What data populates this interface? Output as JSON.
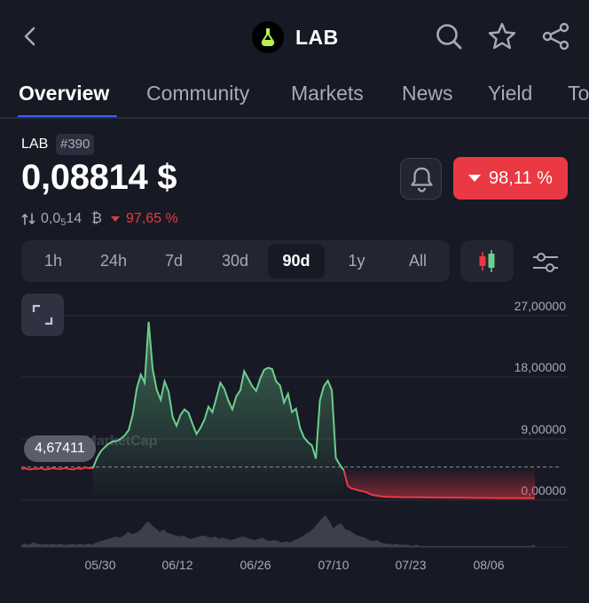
{
  "header": {
    "title": "LAB",
    "back_icon": "chevron-left-icon",
    "logo_icon": "lab-flask-logo",
    "actions": [
      "search-icon",
      "star-icon",
      "share-icon"
    ]
  },
  "tabs": [
    {
      "label": "Overview",
      "active": true
    },
    {
      "label": "Community"
    },
    {
      "label": "Markets"
    },
    {
      "label": "News"
    },
    {
      "label": "Yield"
    },
    {
      "label": "To"
    }
  ],
  "coin": {
    "symbol": "LAB",
    "rank": "#390",
    "price": "0,08814 $",
    "btc_price_prefix": "0,0",
    "btc_price_zeros": "5",
    "btc_price_digits": "14",
    "btc_unit": "₿",
    "btc_change": "97,65 %",
    "change_90d": "98,11 %"
  },
  "ranges": [
    "1h",
    "24h",
    "7d",
    "30d",
    "90d",
    "1y",
    "All"
  ],
  "selected_range": "90d",
  "colors": {
    "background": "#171924",
    "up": "#6ccf8e",
    "down": "#ea3943",
    "accent": "#3861fb",
    "panel": "#222532"
  },
  "chart_data": {
    "type": "line",
    "watermark": "CoinMarketCap",
    "y_ticks": [
      "27,00000",
      "18,00000",
      "9,00000",
      "0,00000"
    ],
    "ylim": [
      -0.3,
      27
    ],
    "x_ticks": [
      "05/30",
      "06/12",
      "06/26",
      "07/10",
      "07/23",
      "08/06"
    ],
    "current_marker": "4,67411",
    "baseline": 4.67,
    "series": [
      {
        "values": [
          4.4,
          4.5,
          4.3,
          4.4,
          4.4,
          4.5,
          4.3,
          4.4,
          4.5,
          4.4,
          4.4,
          4.5,
          4.4,
          4.3,
          4.5,
          4.4,
          4.6,
          4.5,
          4.5,
          6.0,
          7.0,
          7.6,
          8.1,
          8.4,
          8.5,
          8.8,
          9.3,
          10.1,
          12.4,
          16.2,
          18.2,
          17.0,
          25.9,
          19.0,
          16.0,
          14.5,
          17.2,
          15.7,
          12.0,
          10.7,
          12.3,
          13.1,
          12.6,
          11.0,
          9.5,
          10.4,
          11.6,
          13.5,
          12.7,
          14.8,
          17.0,
          16.1,
          14.4,
          13.1,
          15.0,
          15.9,
          18.7,
          17.6,
          16.5,
          15.8,
          17.6,
          18.9,
          19.2,
          19.0,
          17.2,
          16.6,
          14.1,
          15.4,
          12.7,
          13.2,
          10.4,
          9.0,
          8.3,
          7.8,
          5.9,
          14.4,
          16.5,
          17.3,
          15.9,
          6.0,
          5.0,
          4.2,
          1.9,
          1.5,
          1.4,
          1.2,
          1.1,
          0.9,
          0.6,
          0.5,
          0.4,
          0.35,
          0.3,
          0.3,
          0.28,
          0.27,
          0.26,
          0.26,
          0.25,
          0.24,
          0.24,
          0.23,
          0.22,
          0.22,
          0.21,
          0.21,
          0.2,
          0.2,
          0.19,
          0.19,
          0.18,
          0.18,
          0.17,
          0.17,
          0.16,
          0.16,
          0.15,
          0.15,
          0.14,
          0.14,
          0.13,
          0.13,
          0.12,
          0.12,
          0.11,
          0.11,
          0.1,
          0.1,
          0.1,
          0.09
        ]
      }
    ],
    "volume": [
      2,
      3,
      2,
      4,
      3,
      2,
      3,
      2,
      3,
      2,
      3,
      2,
      2,
      3,
      2,
      3,
      2,
      3,
      2,
      4,
      5,
      6,
      7,
      8,
      9,
      8,
      10,
      13,
      11,
      12,
      14,
      18,
      22,
      19,
      16,
      13,
      15,
      12,
      11,
      10,
      9,
      10,
      8,
      7,
      8,
      9,
      10,
      9,
      8,
      9,
      7,
      8,
      7,
      6,
      7,
      8,
      9,
      8,
      7,
      6,
      7,
      8,
      6,
      5,
      6,
      5,
      4,
      5,
      4,
      6,
      7,
      9,
      11,
      13,
      16,
      20,
      24,
      27,
      22,
      16,
      19,
      20,
      15,
      14,
      12,
      10,
      9,
      8,
      6,
      5,
      6,
      4,
      3,
      3,
      2,
      3,
      2,
      2,
      2,
      1,
      2,
      1,
      1,
      1,
      1,
      1,
      1,
      1,
      1,
      1,
      1,
      1,
      1,
      1,
      1,
      1,
      1,
      1,
      1,
      1,
      1,
      1,
      1,
      1,
      1,
      1,
      1,
      1,
      1,
      1,
      2
    ]
  }
}
